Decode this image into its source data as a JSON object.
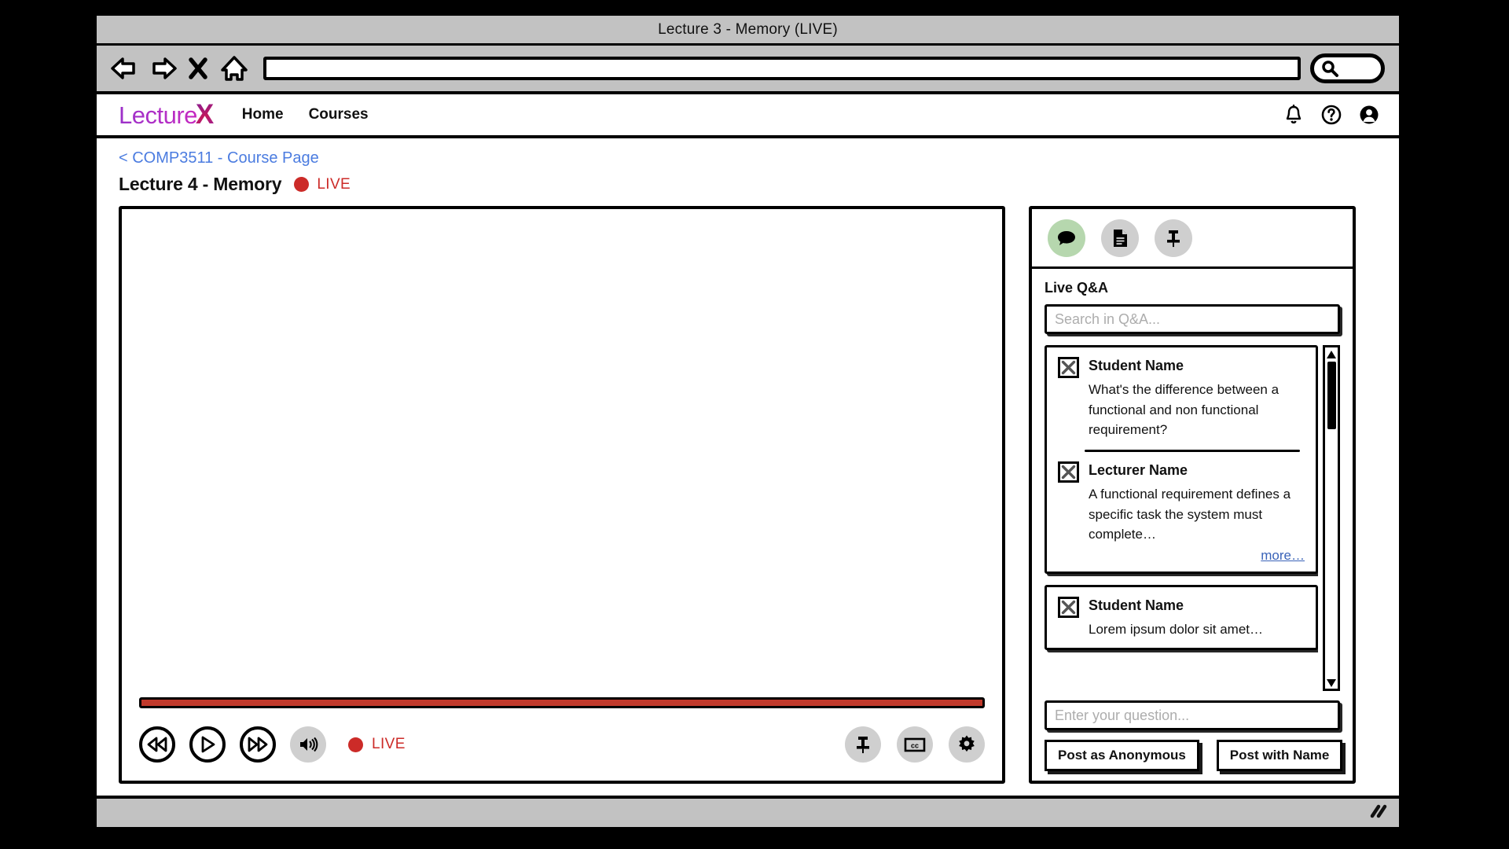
{
  "browser": {
    "window_title": "Lecture 3 - Memory (LIVE)",
    "url_value": "",
    "url_placeholder": "",
    "back_icon": "back-arrow-icon",
    "forward_icon": "forward-arrow-icon",
    "stop_icon": "close-x-icon",
    "home_icon": "home-icon",
    "search_icon": "search-icon"
  },
  "header": {
    "logo_word": "Lecture",
    "logo_x": "X",
    "nav": [
      {
        "label": "Home",
        "name": "nav-link-home"
      },
      {
        "label": "Courses",
        "name": "nav-link-courses"
      }
    ],
    "actions": [
      {
        "name": "notifications-bell-icon"
      },
      {
        "name": "help-circle-icon"
      },
      {
        "name": "account-avatar-icon"
      }
    ]
  },
  "page": {
    "breadcrumb": "< COMP3511 - Course Page",
    "lecture_title": "Lecture 4 - Memory",
    "live_label": "LIVE",
    "live_color": "#cc2b28"
  },
  "player": {
    "progress_percent": 100,
    "progress_color": "#c0392b",
    "live_label": "LIVE",
    "controls_left": [
      {
        "name": "rewind-button",
        "icon": "rewind-icon"
      },
      {
        "name": "play-button",
        "icon": "play-icon"
      },
      {
        "name": "fast-forward-button",
        "icon": "fast-forward-icon"
      },
      {
        "name": "volume-button",
        "icon": "volume-icon"
      }
    ],
    "controls_right": [
      {
        "name": "pin-lecture-button",
        "icon": "pin-icon"
      },
      {
        "name": "captions-button",
        "icon": "cc-icon"
      },
      {
        "name": "settings-button",
        "icon": "gear-icon"
      }
    ]
  },
  "qa": {
    "tabs": [
      {
        "name": "tab-live-qa",
        "icon": "chat-bubble-icon",
        "active": true,
        "active_color": "#b6d7ae"
      },
      {
        "name": "tab-resources",
        "icon": "document-icon",
        "active": false
      },
      {
        "name": "tab-pinned",
        "icon": "pin-icon",
        "active": false
      }
    ],
    "heading": "Live Q&A",
    "search_placeholder": "Search in Q&A...",
    "search_value": "",
    "threads": [
      {
        "messages": [
          {
            "author": "Student Name",
            "text": "What's the difference between a functional and non functional requirement?",
            "avatar": "avatar-placeholder-icon"
          },
          {
            "author": "Lecturer Name",
            "text": "A functional requirement defines a specific task the system must complete…",
            "avatar": "avatar-placeholder-icon"
          }
        ],
        "more_label": "more…"
      },
      {
        "messages": [
          {
            "author": "Student Name",
            "text": "Lorem ipsum dolor sit amet…",
            "avatar": "avatar-placeholder-icon"
          }
        ],
        "more_label": ""
      }
    ],
    "compose_placeholder": "Enter your question...",
    "compose_value": "",
    "post_anonymous_label": "Post as Anonymous",
    "post_with_name_label": "Post with Name",
    "scrollbar": {
      "up_icon": "chevron-up-icon",
      "down_icon": "chevron-down-icon"
    }
  },
  "status_bar": {
    "resize_icon": "resize-grip-icon"
  }
}
